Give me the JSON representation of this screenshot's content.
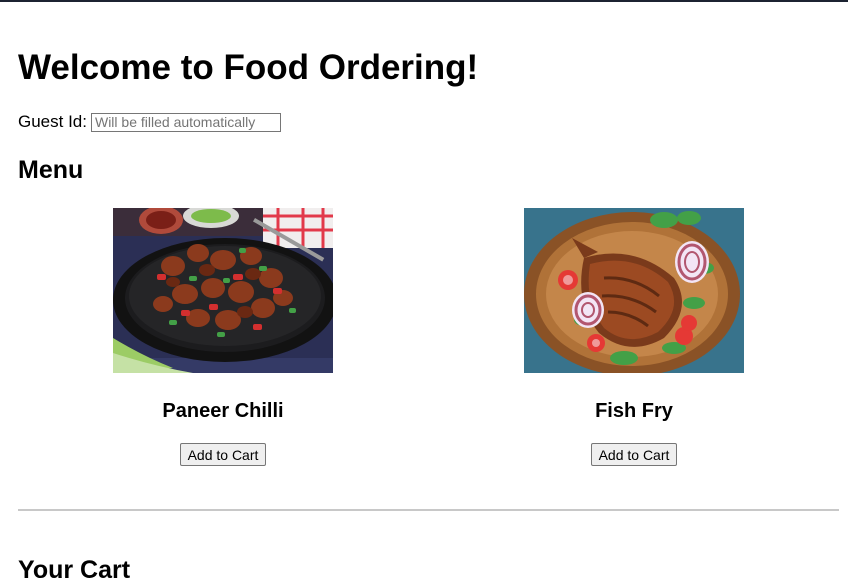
{
  "page": {
    "heading": "Welcome to Food Ordering!",
    "guest": {
      "label": "Guest Id:",
      "value": "",
      "placeholder": "Will be filled automatically"
    },
    "menu_title": "Menu",
    "menu_items": [
      {
        "name": "Paneer Chilli",
        "button_label": "Add to Cart",
        "image": "paneer-chilli-photo"
      },
      {
        "name": "Fish Fry",
        "button_label": "Add to Cart",
        "image": "fish-fry-photo"
      }
    ],
    "cart_title": "Your Cart"
  },
  "colors": {
    "top_bar": "#1c2331",
    "divider": "#c8c8c8",
    "button_bg": "#efefef"
  }
}
